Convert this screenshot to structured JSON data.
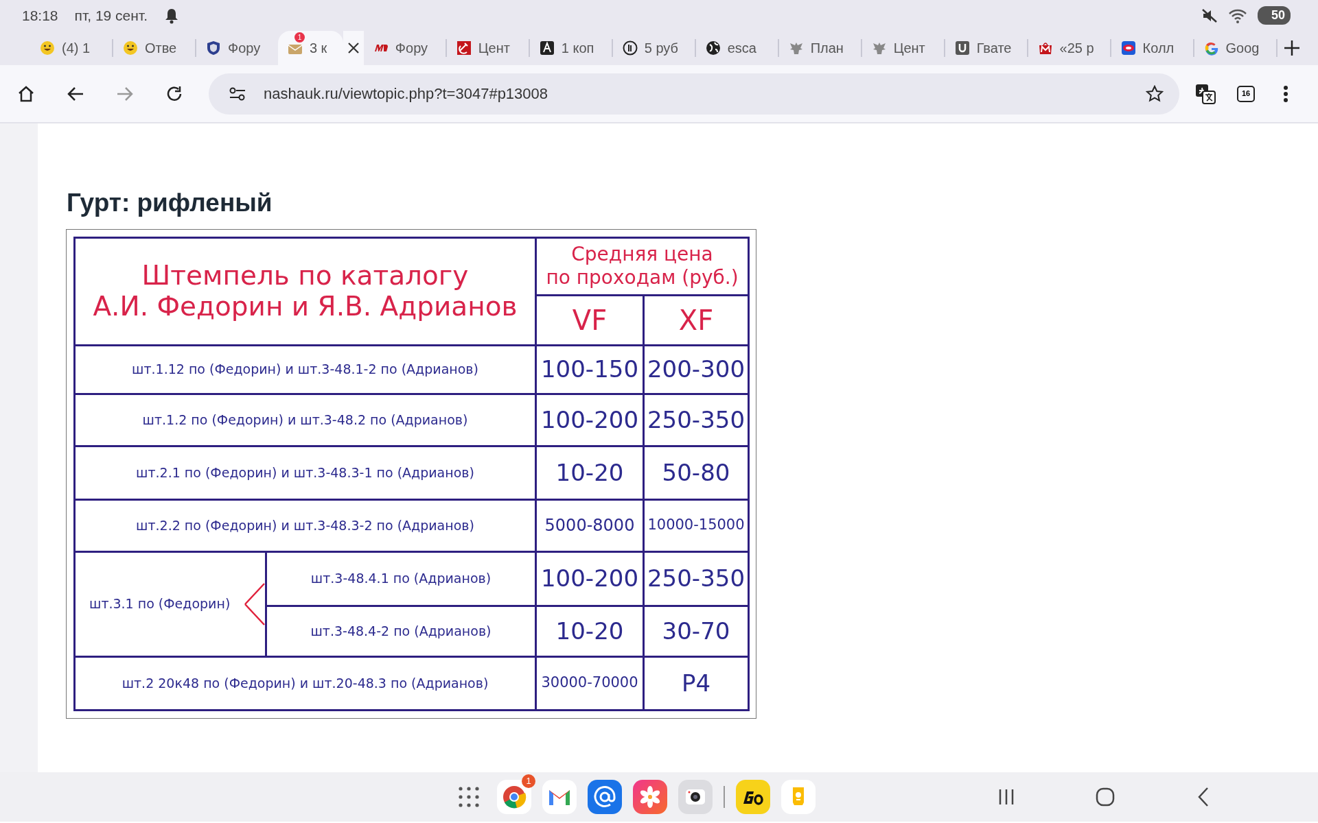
{
  "status_bar": {
    "time": "18:18",
    "date": "пт, 19 сент.",
    "battery": "50"
  },
  "tabs": [
    {
      "label": "(4) 1",
      "selected": false
    },
    {
      "label": "Отве",
      "selected": false
    },
    {
      "label": "Фору",
      "selected": false
    },
    {
      "label": "3 к",
      "selected": true,
      "badge": "1"
    },
    {
      "label": "Фору",
      "selected": false
    },
    {
      "label": "Цент",
      "selected": false
    },
    {
      "label": "1 коп",
      "selected": false
    },
    {
      "label": "5 руб",
      "selected": false
    },
    {
      "label": "esca",
      "selected": false
    },
    {
      "label": "План",
      "selected": false
    },
    {
      "label": "Цент",
      "selected": false
    },
    {
      "label": "Гвате",
      "selected": false
    },
    {
      "label": "«25 р",
      "selected": false
    },
    {
      "label": "Колл",
      "selected": false
    },
    {
      "label": "Goog",
      "selected": false
    }
  ],
  "toolbar": {
    "forward_disabled": true,
    "url": "nashauk.ru/viewtopic.php?t=3047#p13008",
    "tab_count": "16"
  },
  "page": {
    "heading": "Гурт: рифленый",
    "table": {
      "title_lines": [
        "Штемпель по каталогу",
        "А.И. Федорин и Я.В. Адрианов"
      ],
      "price_lines": [
        "Средняя цена",
        "по проходам (руб.)"
      ],
      "grades": [
        "VF",
        "XF"
      ],
      "rows": [
        {
          "kind": "single",
          "stamp": "шт.1.12 по (Федорин) и шт.3-48.1-2 по (Адрианов)",
          "vf": "100-150",
          "xf": "200-300"
        },
        {
          "kind": "single",
          "stamp": "шт.1.2 по (Федорин) и шт.3-48.2 по (Адрианов)",
          "vf": "100-200",
          "xf": "250-350"
        },
        {
          "kind": "single",
          "stamp": "шт.2.1 по (Федорин) и шт.3-48.3-1 по (Адрианов)",
          "vf": "10-20",
          "xf": "50-80"
        },
        {
          "kind": "single",
          "stamp": "шт.2.2 по (Федорин) и шт.3-48.3-2 по (Адрианов)",
          "vf": "5000-8000",
          "xf": "10000-15000"
        },
        {
          "kind": "group",
          "stamp": "шт.3.1 по (Федорин)",
          "subrows": [
            {
              "stamp": "шт.3-48.4.1 по (Адрианов)",
              "vf": "100-200",
              "xf": "250-350"
            },
            {
              "stamp": "шт.3-48.4-2 по (Адрианов)",
              "vf": "10-20",
              "xf": "30-70"
            }
          ]
        },
        {
          "kind": "single",
          "stamp": "шт.2 20к48 по (Федорин) и шт.20-48.3 по (Адрианов)",
          "vf": "30000-70000",
          "xf": "Р4"
        }
      ]
    }
  },
  "taskbar": {
    "chrome_badge": "1"
  }
}
